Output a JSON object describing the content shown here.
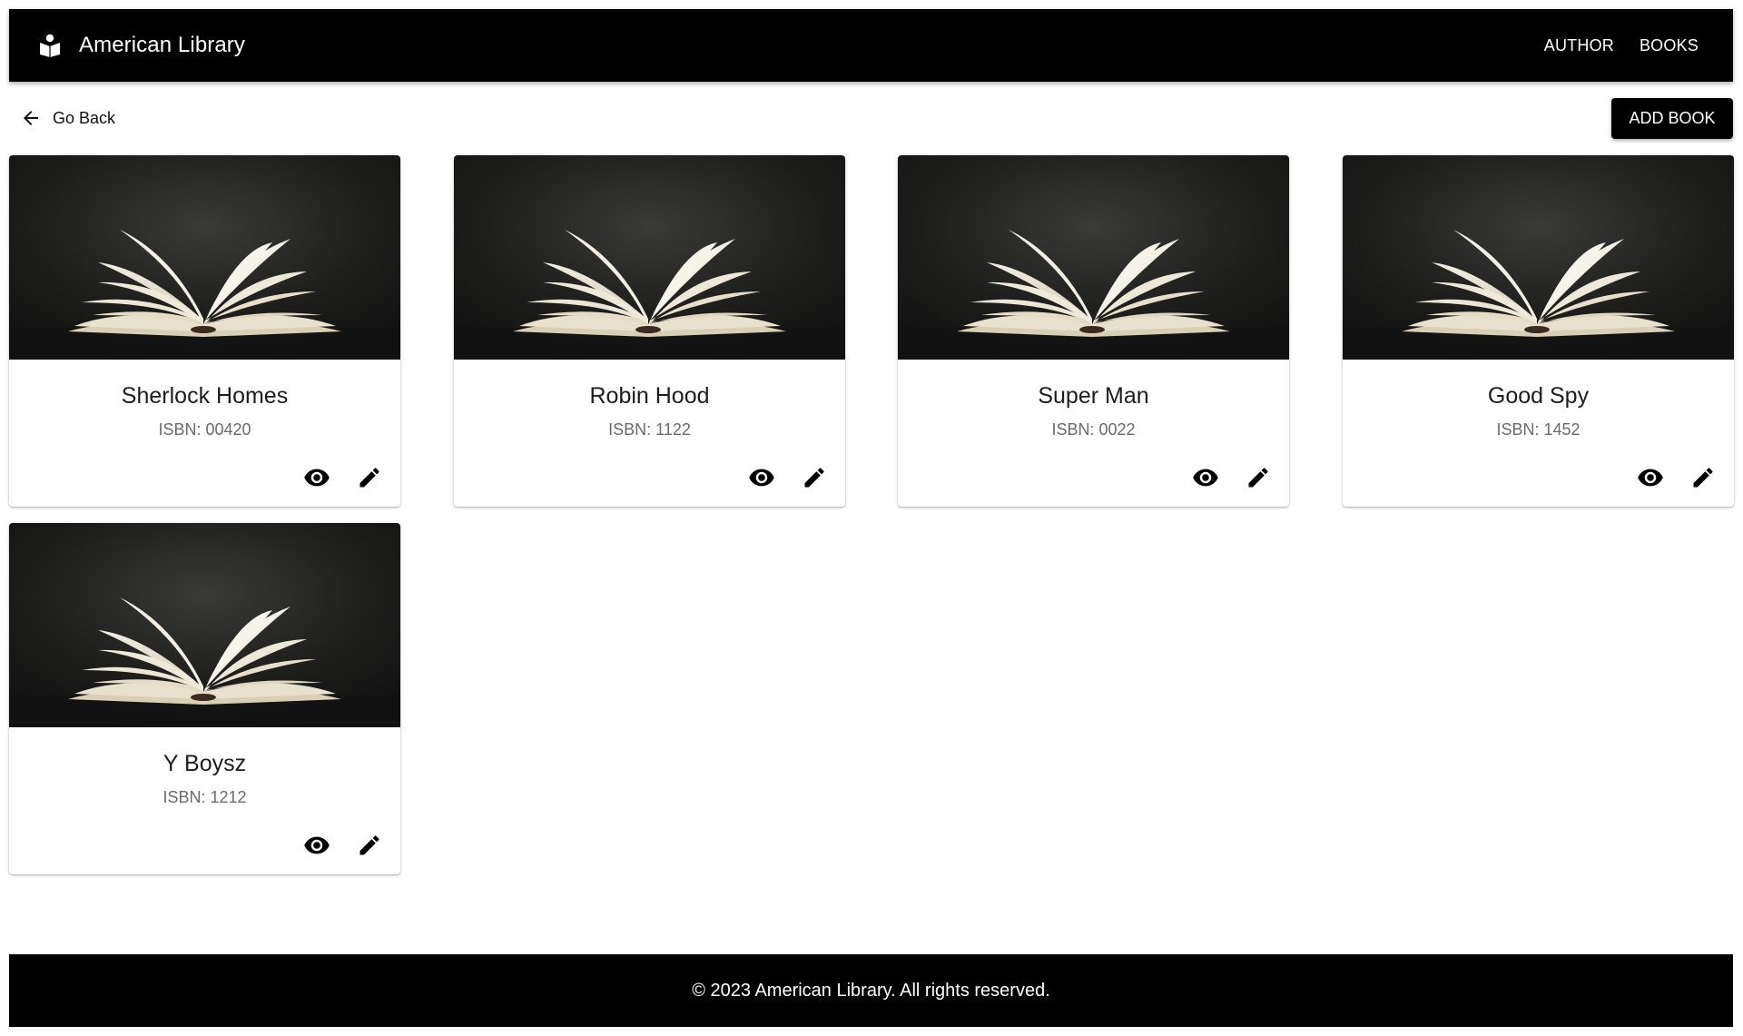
{
  "header": {
    "title": "American Library",
    "nav": [
      {
        "label": "AUTHOR"
      },
      {
        "label": "BOOKS"
      }
    ]
  },
  "toolbar": {
    "back_label": "Go Back",
    "add_label": "ADD BOOK"
  },
  "books": [
    {
      "title": "Sherlock Homes",
      "isbn": "ISBN: 00420"
    },
    {
      "title": "Robin Hood",
      "isbn": "ISBN: 1122"
    },
    {
      "title": "Super Man",
      "isbn": "ISBN: 0022"
    },
    {
      "title": "Good Spy",
      "isbn": "ISBN: 1452"
    },
    {
      "title": "Y Boysz",
      "isbn": "ISBN: 1212"
    }
  ],
  "footer": {
    "text": "© 2023 American Library. All rights reserved."
  },
  "icons": {
    "brand": "reading-book-icon",
    "back": "arrow-left-icon",
    "view": "eye-icon",
    "edit": "pencil-icon",
    "cover": "open-book-image"
  },
  "colors": {
    "header_bg": "#000000",
    "footer_bg": "#000000",
    "button_bg": "#000000",
    "isbn_text": "#6b6b6b"
  }
}
